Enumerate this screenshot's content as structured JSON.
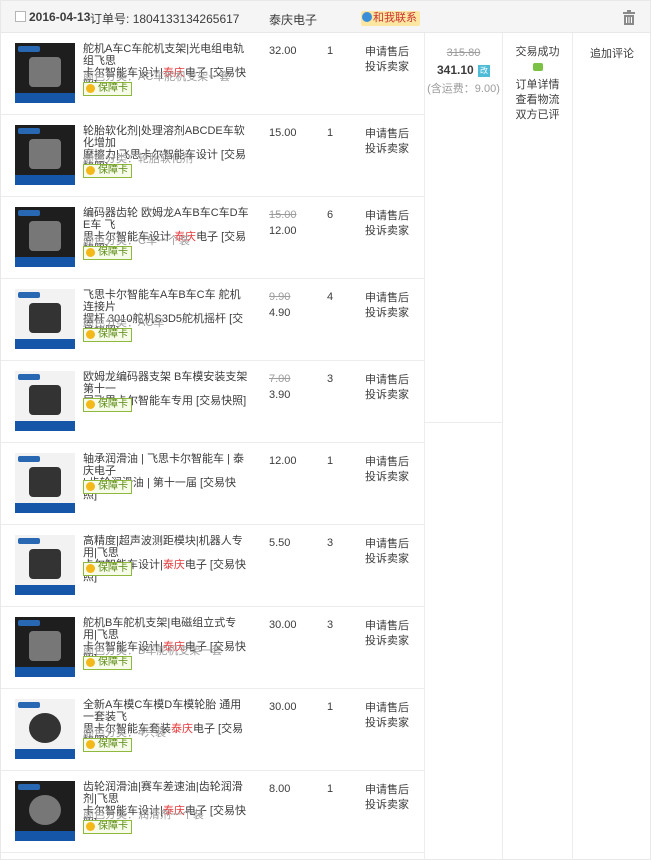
{
  "header": {
    "date": "2016-04-13",
    "order_label": "订单号:",
    "order_no": "1804133134265617",
    "shop": "泰庆电子",
    "contact": "和我联系"
  },
  "items": [
    {
      "t1": "舵机A车C车舵机支架|光电组电轨组飞思",
      "t2a": "卡尔智能车设计|",
      "t2r": "泰庆",
      "t2b": "电子 [交易快照]",
      "attr": "颜色分类：AC车舵机支架一套",
      "badge": "保障卡",
      "orig": "",
      "price": "32.00",
      "qty": "1",
      "a1": "申请售后",
      "a2": "投诉卖家"
    },
    {
      "t1": "轮胎软化剂|处理溶剂ABCDE车软化增加",
      "t2a": "摩擦力|飞思卡尔智能车设计 [交易快照]",
      "t2r": "",
      "t2b": "",
      "attr": "颜色分类：轮胎软化剂",
      "badge": "保障卡",
      "orig": "",
      "price": "15.00",
      "qty": "1",
      "a1": "申请售后",
      "a2": "投诉卖家"
    },
    {
      "t1": "编码器齿轮 欧姆龙A车B车C车D车E车 飞",
      "t2a": "思卡尔智能车设计 ",
      "t2r": "泰庆",
      "t2b": "电子 [交易快照]",
      "attr": "颜色分类：C车一个装",
      "badge": "保障卡",
      "orig": "15.00",
      "price": "12.00",
      "qty": "6",
      "a1": "申请售后",
      "a2": "投诉卖家"
    },
    {
      "t1": "飞思卡尔智能车A车B车C车 舵机连接片",
      "t2a": "摆杆 3010舵机S3D5舵机摇杆 [交易快照]",
      "t2r": "",
      "t2b": "",
      "attr": "颜色分类：AC车",
      "badge": "保障卡",
      "orig": "9.90",
      "price": "4.90",
      "qty": "4",
      "a1": "申请售后",
      "a2": "投诉卖家"
    },
    {
      "t1": "欧姆龙编码器支架 B车模安装支架 第十一",
      "t2a": "届飞思卡尔智能车专用 [交易快照]",
      "t2r": "",
      "t2b": "",
      "attr": "",
      "badge": "保障卡",
      "orig": "7.00",
      "price": "3.90",
      "qty": "3",
      "a1": "申请售后",
      "a2": "投诉卖家"
    },
    {
      "t1": "轴承润滑油 | 飞思卡尔智能车 | 泰庆电子",
      "t2a": "| 齿轮润滑油 | 第十一届 [交易快照]",
      "t2r": "",
      "t2b": "",
      "attr": "",
      "badge": "保障卡",
      "orig": "",
      "price": "12.00",
      "qty": "1",
      "a1": "申请售后",
      "a2": "投诉卖家"
    },
    {
      "t1": "高精度|超声波测距模块|机器人专用|飞思",
      "t2a": "卡尔智能车设计|",
      "t2r": "泰庆",
      "t2b": "电子 [交易快照]",
      "attr": "",
      "badge": "保障卡",
      "orig": "",
      "price": "5.50",
      "qty": "3",
      "a1": "申请售后",
      "a2": "投诉卖家"
    },
    {
      "t1": "舵机B车舵机支架|电磁组立式专用|飞思",
      "t2a": "卡尔智能车设计|",
      "t2r": "泰庆",
      "t2b": "电子 [交易快照]",
      "attr": "颜色分类：B车舵机支架一套",
      "badge": "保障卡",
      "orig": "",
      "price": "30.00",
      "qty": "3",
      "a1": "申请售后",
      "a2": "投诉卖家"
    },
    {
      "t1": "全新A车模C车模D车模轮胎 通用一套装飞",
      "t2a": "思卡尔智能车套装",
      "t2r": "泰庆",
      "t2b": "电子 [交易快照]",
      "attr": "颜色分类：4只装",
      "badge": "保障卡",
      "orig": "",
      "price": "30.00",
      "qty": "1",
      "a1": "申请售后",
      "a2": "投诉卖家"
    },
    {
      "t1": "齿轮润滑油|赛车差速油|齿轮润滑剂|飞思",
      "t2a": "卡尔智能车设计|",
      "t2r": "泰庆",
      "t2b": "电子 [交易快照]",
      "attr": "颜色分类：润滑剂一个装",
      "badge": "保障卡",
      "orig": "",
      "price": "8.00",
      "qty": "1",
      "a1": "申请售后",
      "a2": "投诉卖家"
    }
  ],
  "total": {
    "orig": "315.80",
    "amount": "341.10",
    "tag": "改",
    "shipping": "(含运费：9.00)"
  },
  "status": {
    "state": "交易成功",
    "detail": "订单详情",
    "logistics": "查看物流",
    "rated": "双方已评"
  },
  "ops": {
    "review": "追加评论"
  }
}
